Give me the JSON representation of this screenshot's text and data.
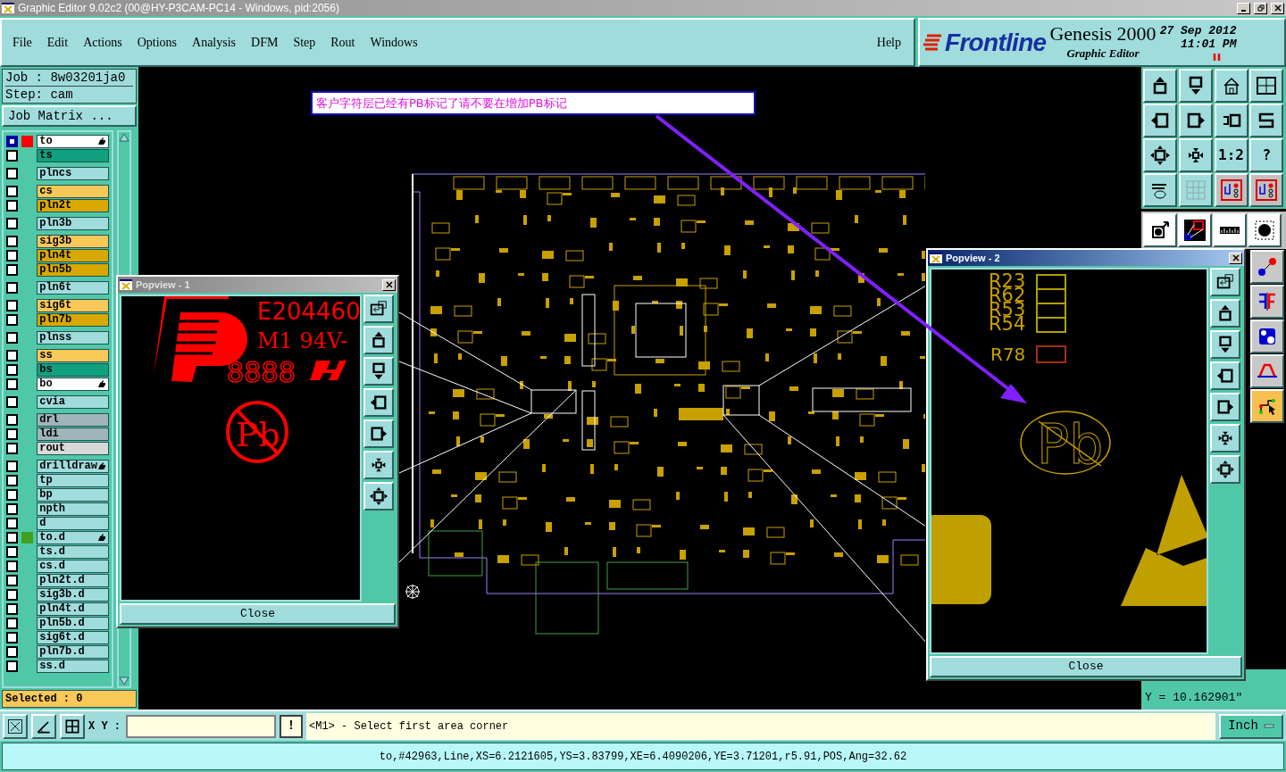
{
  "window": {
    "title": "Graphic Editor 9.02c2 (00@HY-P3CAM-PC14 - Windows, pid:2056)"
  },
  "menu": [
    {
      "label": "File"
    },
    {
      "label": "Edit"
    },
    {
      "label": "Actions"
    },
    {
      "label": "Options"
    },
    {
      "label": "Analysis"
    },
    {
      "label": "DFM"
    },
    {
      "label": "Step"
    },
    {
      "label": "Rout"
    },
    {
      "label": "Windows"
    }
  ],
  "help": "Help",
  "brand": {
    "logo": "Frontline",
    "product": "Genesis 2000",
    "subtitle": "Graphic Editor",
    "date": "27 Sep 2012",
    "time": "11:01 PM"
  },
  "job_panel": {
    "job": "Job : 8w03201ja0",
    "step": "Step: cam",
    "matrix_button": "Job Matrix ...",
    "selected": "Selected : 0",
    "layer_groups": [
      [
        {
          "name": "to",
          "kind": "silk",
          "selected": true,
          "color": "#ff0000",
          "editing": true
        },
        {
          "name": "ts",
          "kind": "mask",
          "selected": false,
          "editing": false
        }
      ],
      [
        {
          "name": "plncs",
          "kind": "misc",
          "selected": false,
          "editing": false
        }
      ],
      [
        {
          "name": "cs",
          "kind": "signal",
          "selected": false,
          "editing": false
        },
        {
          "name": "pln2t",
          "kind": "plane",
          "selected": false,
          "editing": false
        }
      ],
      [
        {
          "name": "pln3b",
          "kind": "misc",
          "selected": false,
          "editing": false
        }
      ],
      [
        {
          "name": "sig3b",
          "kind": "signal",
          "selected": false,
          "editing": false
        },
        {
          "name": "pln4t",
          "kind": "plane",
          "selected": false,
          "editing": false
        },
        {
          "name": "pln5b",
          "kind": "plane",
          "selected": false,
          "editing": false
        }
      ],
      [
        {
          "name": "pln6t",
          "kind": "misc",
          "selected": false,
          "editing": false
        }
      ],
      [
        {
          "name": "sig6t",
          "kind": "signal",
          "selected": false,
          "editing": false
        },
        {
          "name": "pln7b",
          "kind": "plane",
          "selected": false,
          "editing": false
        }
      ],
      [
        {
          "name": "plnss",
          "kind": "misc",
          "selected": false,
          "editing": false
        }
      ],
      [
        {
          "name": "ss",
          "kind": "signal",
          "selected": false,
          "editing": false
        },
        {
          "name": "bs",
          "kind": "mask",
          "selected": false,
          "editing": false
        },
        {
          "name": "bo",
          "kind": "silk",
          "selected": false,
          "editing": true
        }
      ],
      [
        {
          "name": "cvia",
          "kind": "misc",
          "selected": false,
          "editing": false
        }
      ],
      [
        {
          "name": "drl",
          "kind": "drill",
          "selected": false,
          "editing": false
        },
        {
          "name": "ldi",
          "kind": "drill",
          "selected": false,
          "editing": false
        },
        {
          "name": "rout",
          "kind": "rout",
          "selected": false,
          "editing": false
        }
      ],
      [
        {
          "name": "drilldraw",
          "kind": "misc",
          "selected": false,
          "editing": true
        },
        {
          "name": "tp",
          "kind": "misc",
          "selected": false,
          "editing": false
        },
        {
          "name": "bp",
          "kind": "misc",
          "selected": false,
          "editing": false
        },
        {
          "name": "npth",
          "kind": "misc",
          "selected": false,
          "editing": false
        },
        {
          "name": "d",
          "kind": "misc",
          "selected": false,
          "editing": false
        },
        {
          "name": "to.d",
          "kind": "misc",
          "selected": false,
          "color": "#40a020",
          "editing": true
        },
        {
          "name": "ts.d",
          "kind": "misc",
          "selected": false,
          "editing": false
        },
        {
          "name": "cs.d",
          "kind": "misc",
          "selected": false,
          "editing": false
        },
        {
          "name": "pln2t.d",
          "kind": "misc",
          "selected": false,
          "editing": false
        },
        {
          "name": "sig3b.d",
          "kind": "misc",
          "selected": false,
          "editing": false
        },
        {
          "name": "pln4t.d",
          "kind": "misc",
          "selected": false,
          "editing": false
        },
        {
          "name": "pln5b.d",
          "kind": "misc",
          "selected": false,
          "editing": false
        },
        {
          "name": "sig6t.d",
          "kind": "misc",
          "selected": false,
          "editing": false
        },
        {
          "name": "pln7b.d",
          "kind": "misc",
          "selected": false,
          "editing": false
        },
        {
          "name": "ss.d",
          "kind": "misc",
          "selected": false,
          "editing": false
        }
      ]
    ]
  },
  "annotation": {
    "text": "客户字符层已经有PB标记了请不要在增加PB标记"
  },
  "toolbar": {
    "ratio": "1:2",
    "help": "?"
  },
  "popviews": [
    {
      "title": "Popview - 1",
      "active": false,
      "texts": [
        "E204460",
        "M1 94V-",
        "8888",
        "Pb"
      ],
      "close": "Close"
    },
    {
      "title": "Popview - 2",
      "active": true,
      "texts": [
        "R23",
        "R62",
        "R53",
        "R54",
        "R78",
        "Pb"
      ],
      "close": "Close"
    }
  ],
  "coordinates": {
    "y": "Y = 10.162901\""
  },
  "command_bar": {
    "xy_label": "X Y :",
    "alert": "!",
    "message": "<M1> - Select first area corner",
    "units": "Inch"
  },
  "status_bar": "to,#42963,Line,XS=6.2121605,YS=3.83799,XE=6.4090206,YE=3.71201,r5.91,POS,Ang=32.62"
}
